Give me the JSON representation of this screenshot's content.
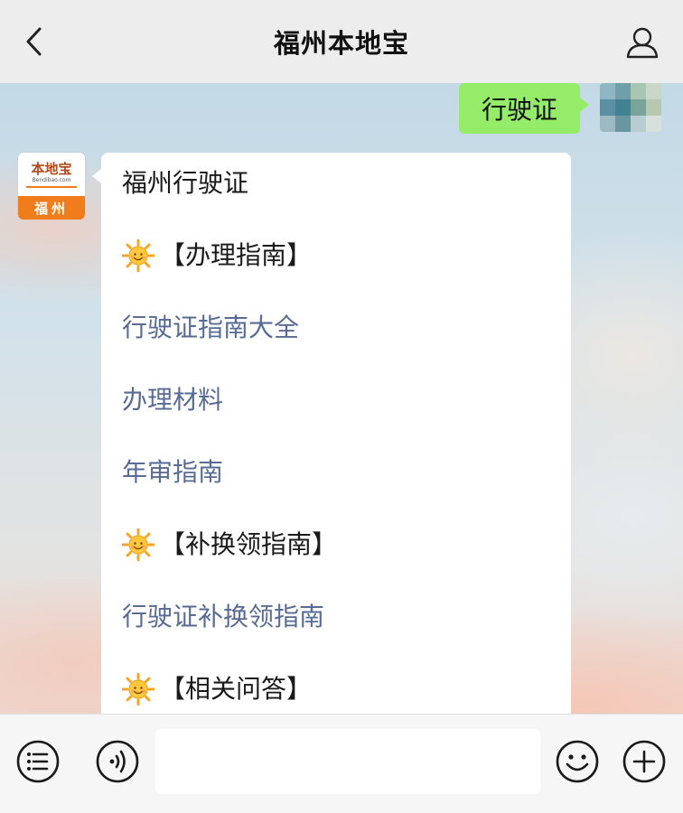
{
  "header": {
    "title": "福州本地宝",
    "back_icon": "chevron-left-icon",
    "profile_icon": "person-icon"
  },
  "messages": {
    "outgoing": {
      "text": "行驶证"
    },
    "bot_avatar": {
      "logo_text": "本地宝",
      "logo_sub": "Bendibao.com",
      "city": "福州",
      "accent_color": "#f07c1c"
    },
    "incoming": {
      "lines": [
        {
          "type": "plain",
          "text": "福州行驶证"
        },
        {
          "type": "heading",
          "icon": "sun-emoji-icon",
          "text": "【办理指南】"
        },
        {
          "type": "link",
          "text": "行驶证指南大全"
        },
        {
          "type": "link",
          "text": "办理材料"
        },
        {
          "type": "link",
          "text": "年审指南"
        },
        {
          "type": "heading",
          "icon": "sun-emoji-icon",
          "text": "【补换领指南】"
        },
        {
          "type": "link",
          "text": "行驶证补换领指南"
        },
        {
          "type": "heading",
          "icon": "sun-emoji-icon",
          "text": "【相关问答】"
        }
      ]
    }
  },
  "bottom_bar": {
    "menu_icon": "list-menu-icon",
    "voice_icon": "voice-icon",
    "input_value": "",
    "emoji_icon": "smiley-icon",
    "plus_icon": "plus-icon"
  },
  "colors": {
    "outgoing_bubble": "#95ec69",
    "link": "#576b95",
    "header_bg": "#ededed"
  }
}
